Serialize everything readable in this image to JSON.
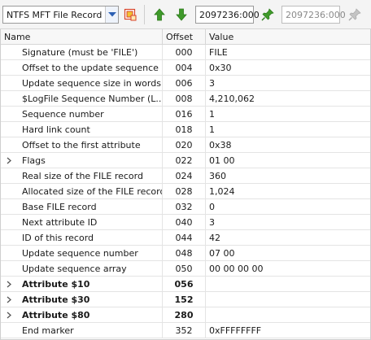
{
  "toolbar": {
    "template_select": "NTFS MFT File Record",
    "address_from": "2097236:000",
    "address_to": "2097236:000"
  },
  "columns": {
    "name": "Name",
    "offset": "Offset",
    "value": "Value"
  },
  "rows": [
    {
      "name": "Signature (must be 'FILE')",
      "offset": "000",
      "value": "FILE",
      "expandable": false,
      "bold": false
    },
    {
      "name": "Offset to the update sequence",
      "offset": "004",
      "value": "0x30",
      "expandable": false,
      "bold": false
    },
    {
      "name": "Update sequence size in words",
      "offset": "006",
      "value": "3",
      "expandable": false,
      "bold": false
    },
    {
      "name": "$LogFile Sequence Number (L...",
      "offset": "008",
      "value": "4,210,062",
      "expandable": false,
      "bold": false
    },
    {
      "name": "Sequence number",
      "offset": "016",
      "value": "1",
      "expandable": false,
      "bold": false
    },
    {
      "name": "Hard link count",
      "offset": "018",
      "value": "1",
      "expandable": false,
      "bold": false
    },
    {
      "name": "Offset to the first attribute",
      "offset": "020",
      "value": "0x38",
      "expandable": false,
      "bold": false
    },
    {
      "name": "Flags",
      "offset": "022",
      "value": "01 00",
      "expandable": true,
      "bold": false
    },
    {
      "name": "Real size of the FILE record",
      "offset": "024",
      "value": "360",
      "expandable": false,
      "bold": false
    },
    {
      "name": "Allocated size of the FILE record",
      "offset": "028",
      "value": "1,024",
      "expandable": false,
      "bold": false
    },
    {
      "name": "Base FILE record",
      "offset": "032",
      "value": "0",
      "expandable": false,
      "bold": false
    },
    {
      "name": "Next attribute ID",
      "offset": "040",
      "value": "3",
      "expandable": false,
      "bold": false
    },
    {
      "name": "ID of this record",
      "offset": "044",
      "value": "42",
      "expandable": false,
      "bold": false
    },
    {
      "name": "Update sequence number",
      "offset": "048",
      "value": "07 00",
      "expandable": false,
      "bold": false
    },
    {
      "name": "Update sequence array",
      "offset": "050",
      "value": "00 00 00 00",
      "expandable": false,
      "bold": false
    },
    {
      "name": "Attribute $10",
      "offset": "056",
      "value": "",
      "expandable": true,
      "bold": true
    },
    {
      "name": "Attribute $30",
      "offset": "152",
      "value": "",
      "expandable": true,
      "bold": true
    },
    {
      "name": "Attribute $80",
      "offset": "280",
      "value": "",
      "expandable": true,
      "bold": true
    },
    {
      "name": "End marker",
      "offset": "352",
      "value": "0xFFFFFFFF",
      "expandable": false,
      "bold": false
    }
  ],
  "icons": {
    "dropdown": "chevron-down-icon",
    "template_editor": "template-editor-icon",
    "prev": "arrow-up-icon",
    "next": "arrow-down-icon",
    "goto": "pin-icon",
    "goto_disabled": "pin-disabled-icon"
  },
  "colors": {
    "accent_blue": "#2b5fb3",
    "arrow_green": "#3f9a2a",
    "template_red": "#d9442a",
    "template_yellow": "#f1c232"
  }
}
